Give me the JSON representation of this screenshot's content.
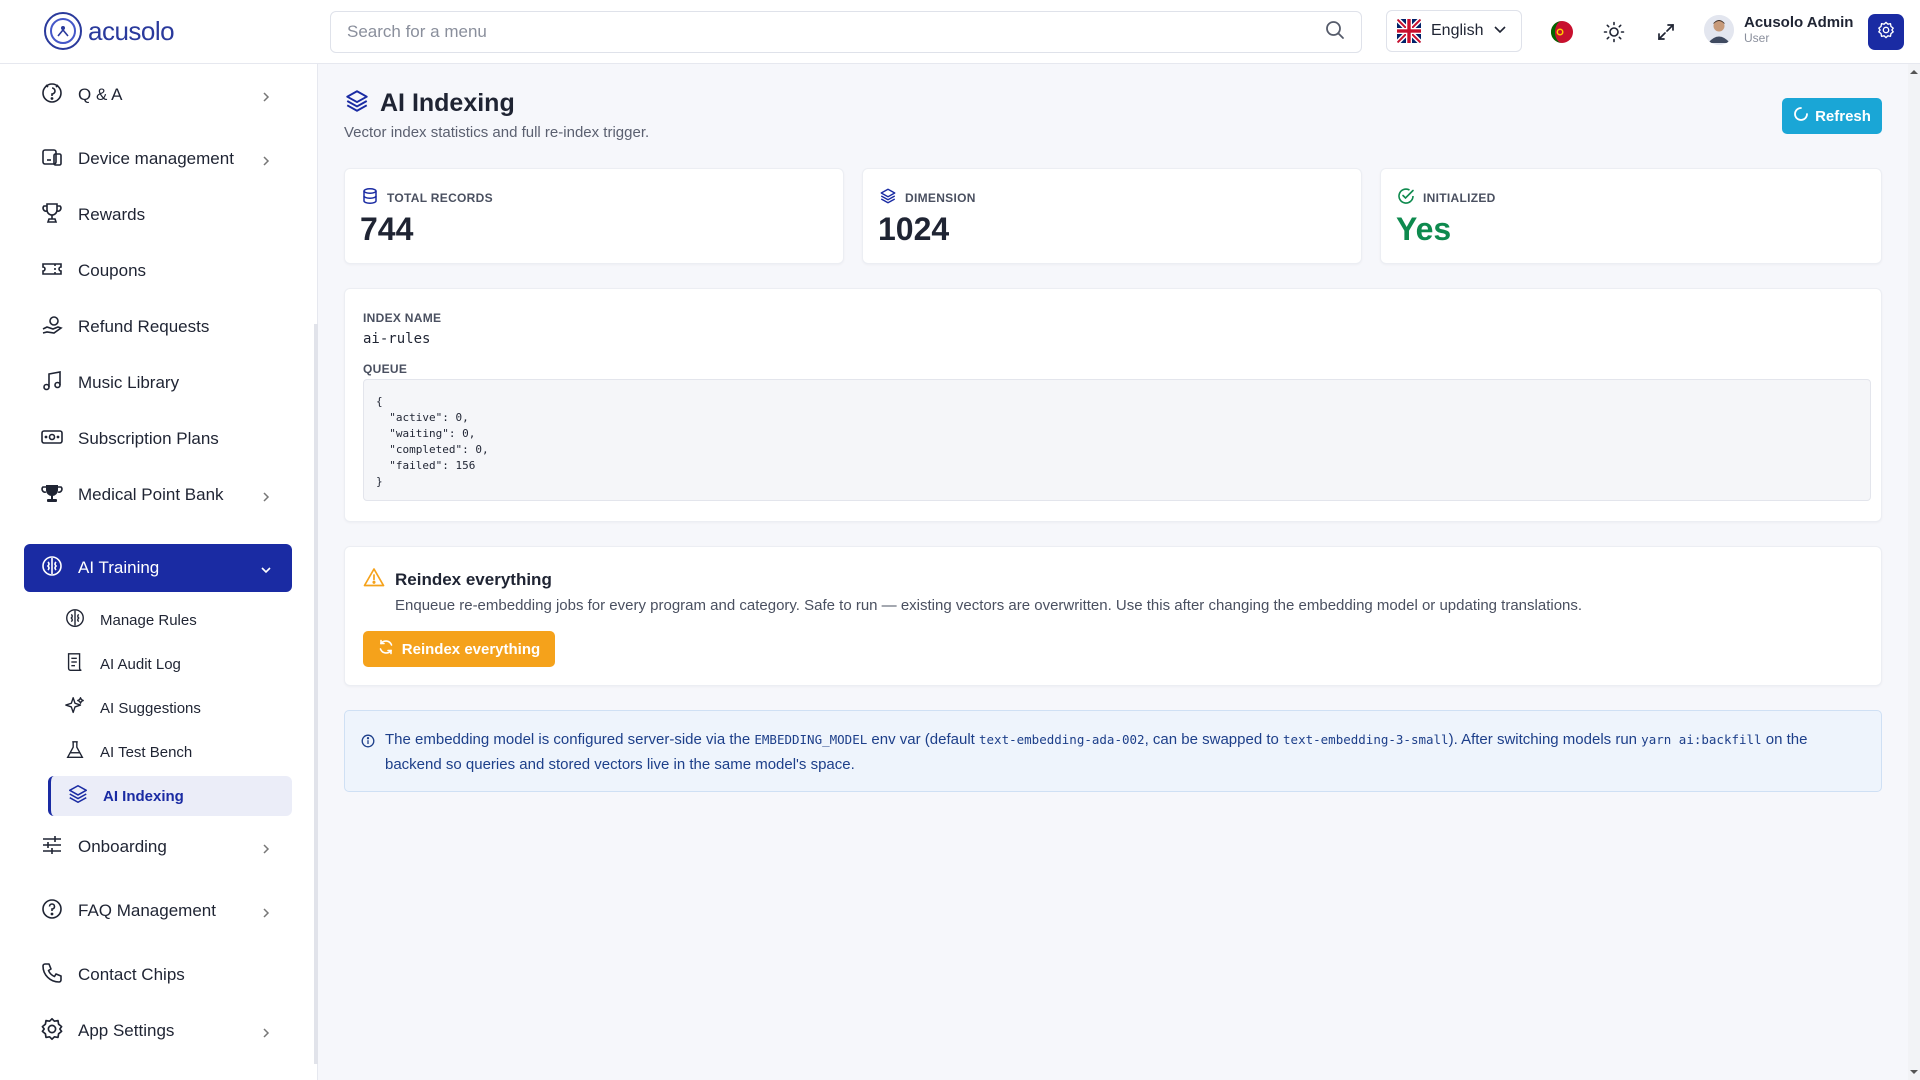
{
  "header": {
    "logo_text": "acusolo",
    "search_placeholder": "Search for a menu",
    "language": "English",
    "user_name": "Acusolo Admin",
    "user_role": "User"
  },
  "sidebar": {
    "items": [
      {
        "label": "Q & A",
        "icon": "qa-icon",
        "has_chevron": true
      },
      {
        "label": "Device management",
        "icon": "device-icon",
        "has_chevron": true
      },
      {
        "label": "Rewards",
        "icon": "trophy-icon",
        "has_chevron": false
      },
      {
        "label": "Coupons",
        "icon": "ticket-icon",
        "has_chevron": false
      },
      {
        "label": "Refund Requests",
        "icon": "refund-icon",
        "has_chevron": false
      },
      {
        "label": "Music Library",
        "icon": "music-icon",
        "has_chevron": false
      },
      {
        "label": "Subscription Plans",
        "icon": "cash-icon",
        "has_chevron": false
      },
      {
        "label": "Medical Point Bank",
        "icon": "cup-icon",
        "has_chevron": true
      },
      {
        "label": "AI Training",
        "icon": "brain-icon",
        "has_chevron": true,
        "active": true
      },
      {
        "label": "Onboarding",
        "icon": "sliders-icon",
        "has_chevron": true
      },
      {
        "label": "FAQ Management",
        "icon": "help-icon",
        "has_chevron": true
      },
      {
        "label": "Contact Chips",
        "icon": "phone-icon",
        "has_chevron": false
      },
      {
        "label": "App Settings",
        "icon": "gear-icon",
        "has_chevron": true
      }
    ],
    "sub_items": [
      {
        "label": "Manage Rules",
        "icon": "brain-icon"
      },
      {
        "label": "AI Audit Log",
        "icon": "log-icon"
      },
      {
        "label": "AI Suggestions",
        "icon": "sparkle-icon"
      },
      {
        "label": "AI Test Bench",
        "icon": "flask-icon"
      },
      {
        "label": "AI Indexing",
        "icon": "layers-icon",
        "active": true
      }
    ]
  },
  "main": {
    "title": "AI Indexing",
    "subtitle": "Vector index statistics and full re-index trigger.",
    "refresh_label": "Refresh",
    "stats": [
      {
        "label": "TOTAL RECORDS",
        "value": "744",
        "icon": "database-icon"
      },
      {
        "label": "DIMENSION",
        "value": "1024",
        "icon": "layers-icon"
      },
      {
        "label": "INITIALIZED",
        "value": "Yes",
        "icon": "check-circle-icon"
      }
    ],
    "index_name_label": "INDEX NAME",
    "index_name": "ai-rules",
    "queue_label": "QUEUE",
    "queue_json": "{\n  \"active\": 0,\n  \"waiting\": 0,\n  \"completed\": 0,\n  \"failed\": 156\n}",
    "reindex": {
      "title": "Reindex everything",
      "description": "Enqueue re-embedding jobs for every program and category. Safe to run — existing vectors are overwritten. Use this after changing the embedding model or updating translations.",
      "button_label": "Reindex everything"
    },
    "info": {
      "t1": "The embedding model is configured server-side via the ",
      "c1": "EMBEDDING_MODEL",
      "t2": " env var (default ",
      "c2": "text-embedding-ada-002",
      "t3": ", can be swapped to ",
      "c3": "text-embedding-3-small",
      "t4": "). After switching models run ",
      "c4": "yarn ai:backfill",
      "t5": " on the backend so queries and stored vectors live in the same model's space."
    }
  },
  "colors": {
    "primary": "#1a2ba3",
    "refresh": "#1aa6d6",
    "warning": "#f5a21b",
    "success": "#0e8a4e"
  }
}
